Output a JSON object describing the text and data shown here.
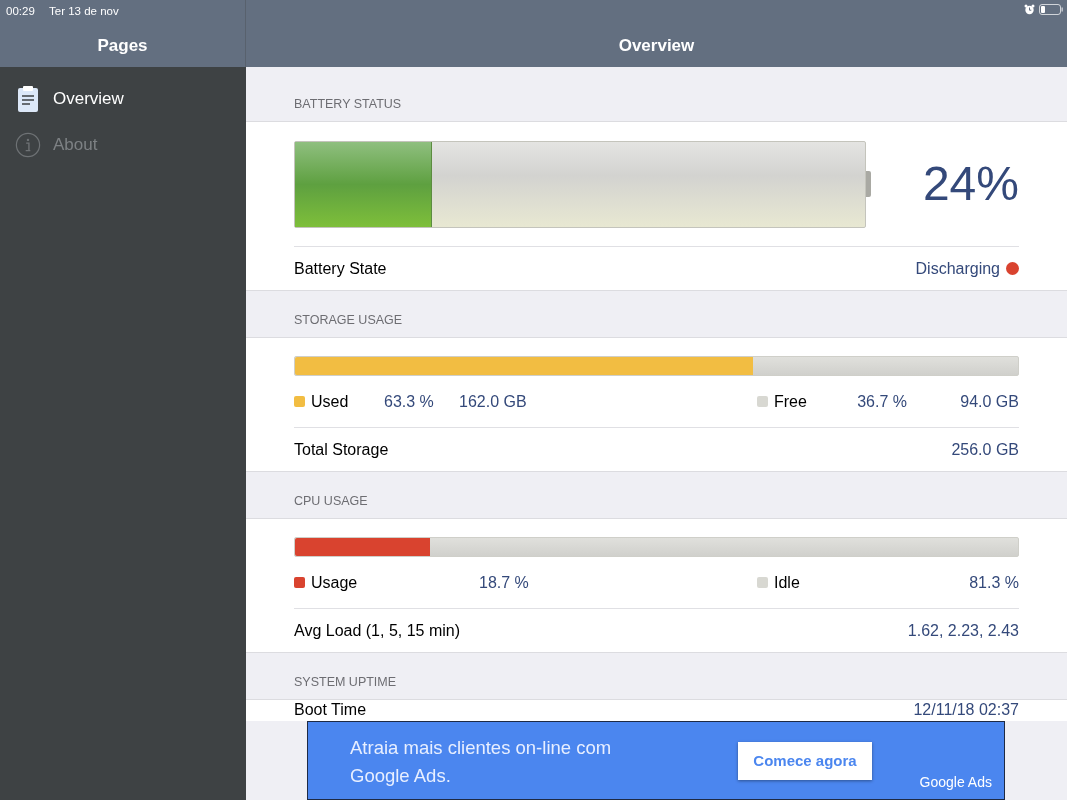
{
  "status_bar": {
    "time": "00:29",
    "date": "Ter 13 de nov"
  },
  "sidebar": {
    "title": "Pages",
    "items": [
      {
        "label": "Overview",
        "selected": true,
        "kind": "clipboard"
      },
      {
        "label": "About",
        "selected": false,
        "kind": "info"
      }
    ]
  },
  "main": {
    "title": "Overview"
  },
  "battery": {
    "section_title": "BATTERY STATUS",
    "level": 0.24,
    "percent": "24%",
    "state": {
      "label": "Battery State",
      "value": "Discharging",
      "color": "#d9432f"
    }
  },
  "storage": {
    "section_title": "STORAGE USAGE",
    "level": 0.633,
    "legend": [
      {
        "label": "Used",
        "color": "#f2bd42",
        "percent": "63.3 %",
        "size": "162.0 GB"
      },
      {
        "label": "Free",
        "color": "#d8d8d2",
        "percent": "36.7 %",
        "size": "94.0 GB"
      }
    ],
    "total_label": "Total Storage",
    "total_value": "256.0 GB"
  },
  "cpu": {
    "section_title": "CPU USAGE",
    "level": 0.187,
    "legend": [
      {
        "label": "Usage",
        "color": "#d9432f",
        "percent": "18.7 %"
      },
      {
        "label": "Idle",
        "color": "#d8d8d2",
        "percent": "81.3 %"
      }
    ],
    "avg_label": "Avg Load (1, 5, 15 min)",
    "avg_value": "1.62, 2.23, 2.43"
  },
  "uptime": {
    "section_title": "SYSTEM UPTIME",
    "rows": [
      {
        "label": "Boot Time",
        "value": "12/11/18 02:37"
      }
    ]
  },
  "ad": {
    "text": "Atraia mais clientes on-line com Google Ads.",
    "button": "Comece agora",
    "brand": "Google Ads"
  }
}
